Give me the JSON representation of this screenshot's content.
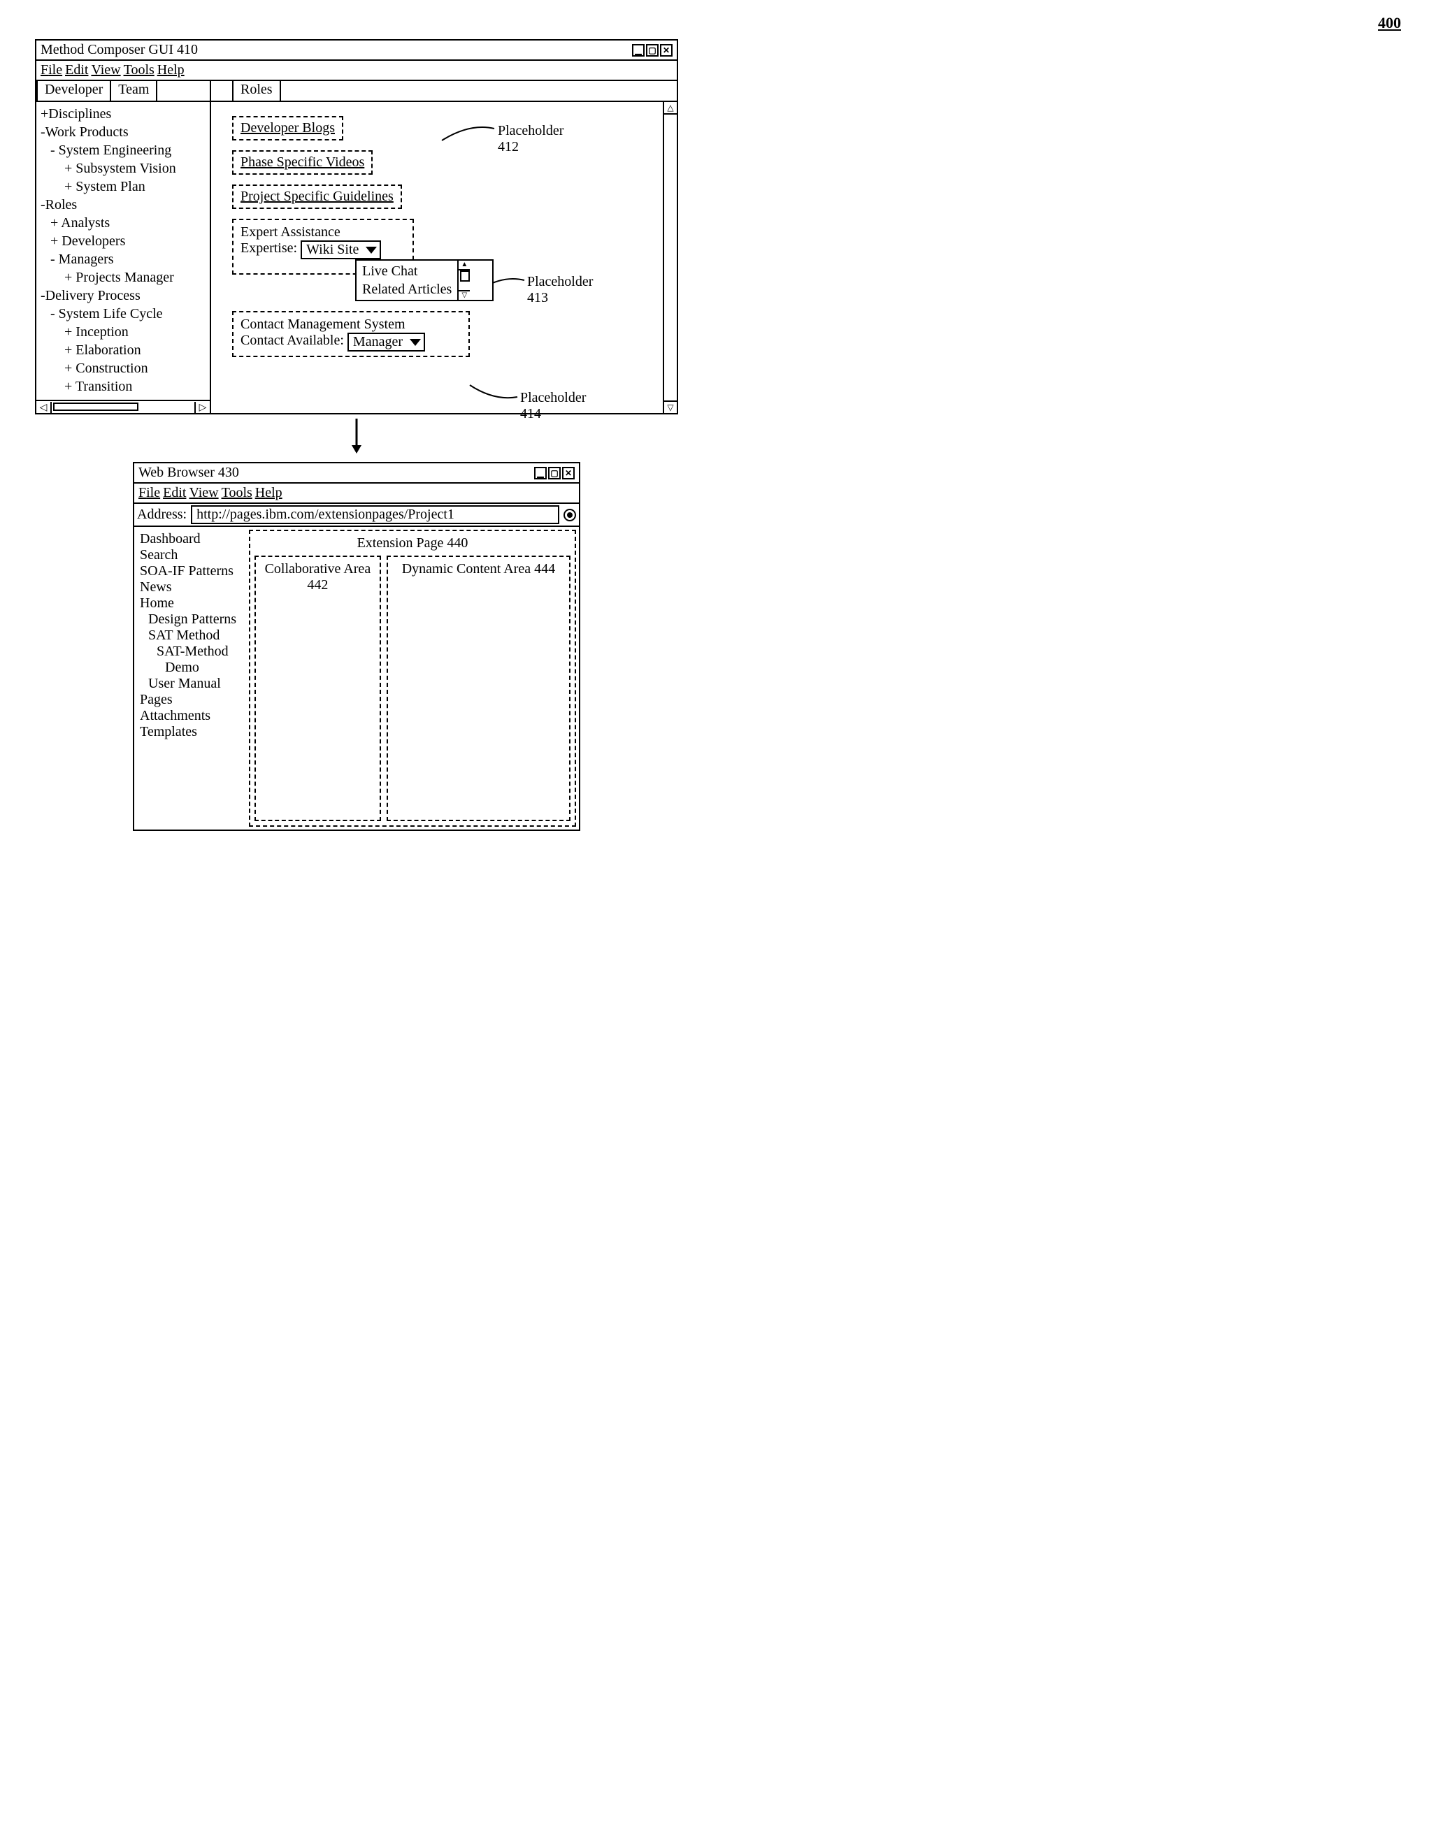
{
  "figure_number": "400",
  "composer": {
    "title": "Method Composer GUI 410",
    "menu": {
      "file": "File",
      "edit": "Edit",
      "view": "View",
      "tools": "Tools",
      "help": "Help"
    },
    "tabs": {
      "developer": "Developer",
      "team": "Team",
      "roles": "Roles"
    },
    "tree": [
      {
        "level": 1,
        "text": "+Disciplines"
      },
      {
        "level": 1,
        "text": "-Work Products"
      },
      {
        "level": 2,
        "text": "- System Engineering"
      },
      {
        "level": 3,
        "text": "+ Subsystem Vision"
      },
      {
        "level": 3,
        "text": "+ System Plan"
      },
      {
        "level": 1,
        "text": "-Roles"
      },
      {
        "level": 2,
        "text": "+ Analysts"
      },
      {
        "level": 2,
        "text": "+ Developers"
      },
      {
        "level": 2,
        "text": "- Managers"
      },
      {
        "level": 3,
        "text": "+ Projects Manager"
      },
      {
        "level": 1,
        "text": "-Delivery Process"
      },
      {
        "level": 2,
        "text": "- System Life Cycle"
      },
      {
        "level": 3,
        "text": "+ Inception"
      },
      {
        "level": 3,
        "text": "+ Elaboration"
      },
      {
        "level": 3,
        "text": "+ Construction"
      },
      {
        "level": 3,
        "text": "+ Transition"
      }
    ],
    "placeholders": {
      "blogs": "Developer Blogs",
      "videos": "Phase Specific Videos",
      "guidelines": "Project Specific Guidelines",
      "expert_title": "Expert Assistance",
      "expert_label": "Expertise:",
      "expert_selected": "Wiki Site",
      "expert_options": [
        "Live Chat",
        "Related Articles"
      ],
      "contact_title": "Contact Management System",
      "contact_label": "Contact Available:",
      "contact_selected": "Manager"
    },
    "callouts": {
      "p412": "Placeholder 412",
      "p413": "Placeholder 413",
      "p414": "Placeholder 414"
    }
  },
  "browser": {
    "title": "Web Browser 430",
    "menu": {
      "file": "File",
      "edit": "Edit",
      "view": "View",
      "tools": "Tools",
      "help": "Help"
    },
    "address_label": "Address:",
    "address_value": "http://pages.ibm.com/extensionpages/Project1",
    "nav": [
      {
        "level": 1,
        "text": "Dashboard"
      },
      {
        "level": 1,
        "text": "Search"
      },
      {
        "level": 1,
        "text": "SOA-IF Patterns"
      },
      {
        "level": 1,
        "text": "News"
      },
      {
        "level": 1,
        "text": "Home"
      },
      {
        "level": 2,
        "text": "Design Patterns"
      },
      {
        "level": 2,
        "text": "SAT Method"
      },
      {
        "level": 3,
        "text": "SAT-Method"
      },
      {
        "level": 4,
        "text": "Demo"
      },
      {
        "level": 2,
        "text": "User Manual"
      },
      {
        "level": 1,
        "text": "Pages"
      },
      {
        "level": 1,
        "text": "Attachments"
      },
      {
        "level": 1,
        "text": "Templates"
      }
    ],
    "extension": {
      "title": "Extension Page 440",
      "col_a": "Collaborative Area 442",
      "col_b": "Dynamic Content Area 444"
    }
  }
}
